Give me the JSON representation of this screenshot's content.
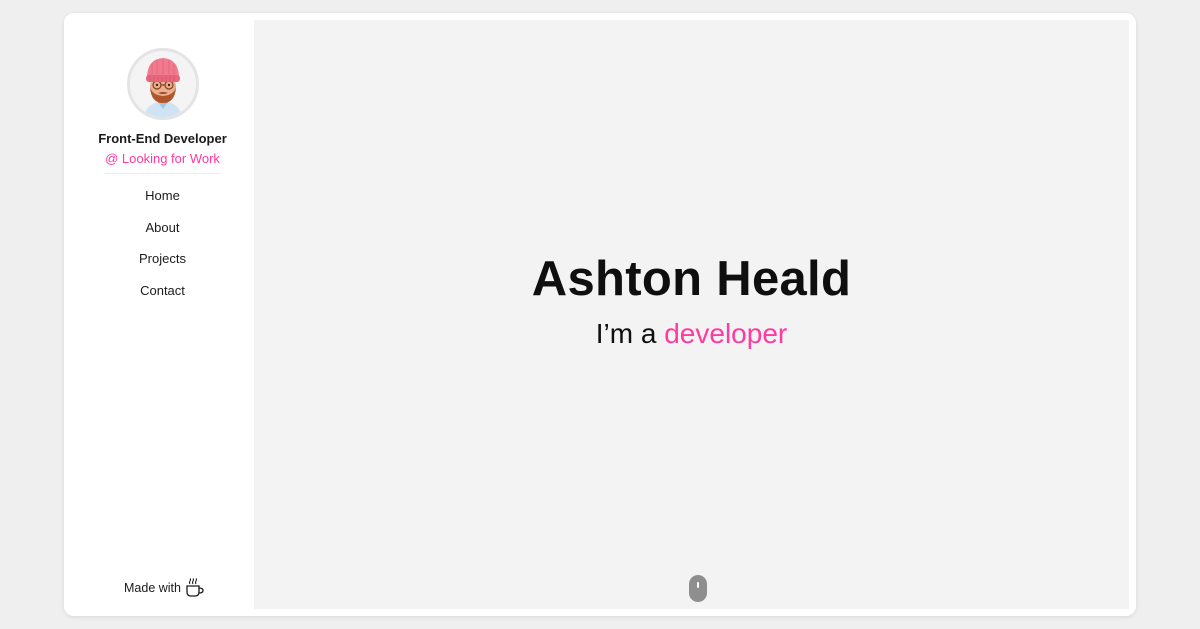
{
  "sidebar": {
    "avatar": "cartoon-avatar-pink-beanie",
    "role": "Front-End Developer",
    "status": "@ Looking for Work",
    "nav": [
      {
        "label": "Home"
      },
      {
        "label": "About"
      },
      {
        "label": "Projects"
      },
      {
        "label": "Contact"
      }
    ],
    "footer": {
      "label": "Made with",
      "icon": "coffee-cup-icon"
    }
  },
  "hero": {
    "name": "Ashton Heald",
    "tagline_prefix": "I’m a",
    "tagline_accent": "developer"
  },
  "colors": {
    "accent": "#ff3aa0",
    "background": "#efefef",
    "panel": "#f3f3f3",
    "text": "#0f0f0f"
  },
  "scroll_indicator": {
    "icon": "mouse-scroll-icon"
  }
}
